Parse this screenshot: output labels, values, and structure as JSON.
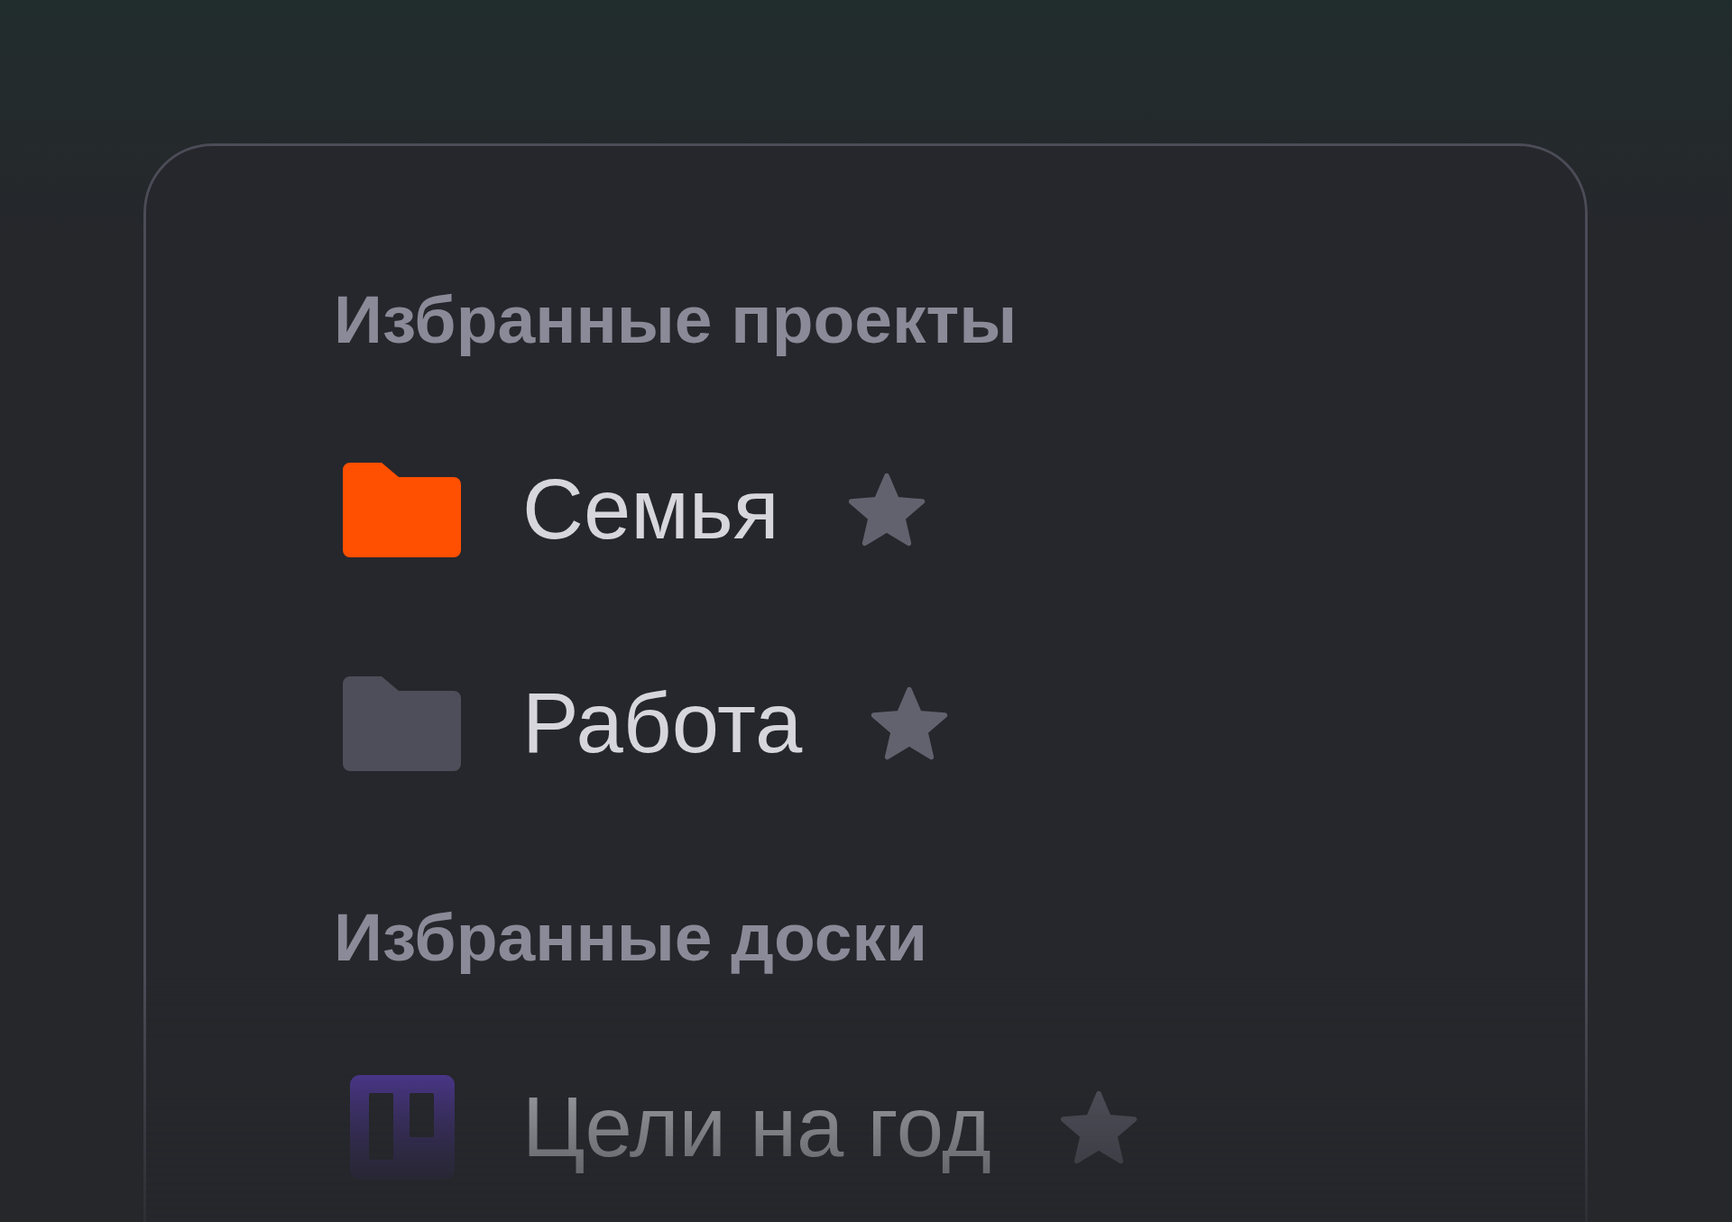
{
  "sections": [
    {
      "title": "Избранные проекты",
      "items": [
        {
          "kind": "folder",
          "label": "Семья",
          "color": "#ff4f00",
          "starred": true
        },
        {
          "kind": "folder",
          "label": "Работа",
          "color": "#4d4e59",
          "starred": true
        }
      ]
    },
    {
      "title": "Избранные доски",
      "items": [
        {
          "kind": "board",
          "label": "Цели на год",
          "starred": true
        }
      ]
    }
  ]
}
